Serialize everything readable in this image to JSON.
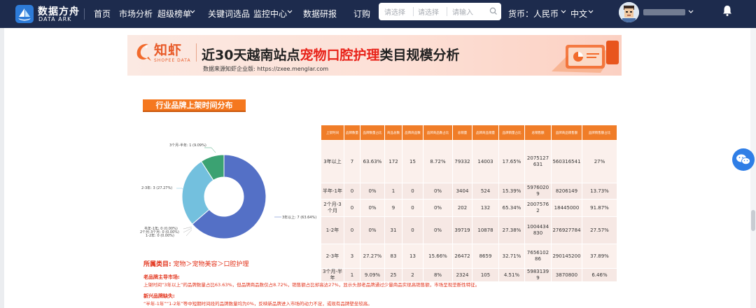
{
  "nav": {
    "logo_cn": "数据方舟",
    "logo_en": "DATA ARK",
    "items": [
      {
        "label": "首页"
      },
      {
        "label": "市场分析"
      },
      {
        "label": "超级榜单"
      },
      {
        "label": "关键词选品"
      },
      {
        "label": "监控中心"
      },
      {
        "label": "数据研报"
      },
      {
        "label": "订购"
      }
    ],
    "search": {
      "select1_placeholder": "请选择",
      "select2_placeholder": "请选择",
      "input_placeholder": "请输入"
    },
    "currency": "货币：人民币",
    "language": "中文"
  },
  "banner": {
    "logo_cn": "知虾",
    "logo_en": "SHOPEE DATA",
    "title_prefix": "近30天越南站点",
    "title_highlight": "宠物口腔护理",
    "title_suffix": "类目规模分析",
    "source": "数据来源知虾企业版: https://zxee.menglar.com"
  },
  "section": {
    "title": "行业品牌上架时间分布"
  },
  "donut": {
    "labels": [
      "3个月-半年: 1 (9.09%)",
      "2-3年: 3 (27.27%)",
      "3年以上: 7 (63.64%)",
      "半年-1年: 0 (0.00%)",
      "2个月-3个月: 0 (0.00%)",
      "1-2年: 0 (0.00%)"
    ],
    "colors": {
      "c1": "#5470c6",
      "c2": "#73c0de",
      "c3": "#3ba272"
    }
  },
  "chart_data": {
    "type": "pie",
    "categories": [
      "3年以上",
      "2-3年",
      "3个月-半年",
      "半年-1年",
      "2个月-3个月",
      "1-2年"
    ],
    "values": [
      7,
      3,
      1,
      0,
      0,
      0
    ]
  },
  "table": {
    "headers": [
      "上架时间",
      "品牌数量",
      "品牌数量占比",
      "商品总数",
      "品牌商品数",
      "品牌商品数占比",
      "总销量",
      "品牌商品销量",
      "品牌销量占比",
      "总销售额",
      "品牌商品销售额",
      "品牌销售额占比"
    ],
    "rows": [
      [
        "3年以上",
        "7",
        "63.63%",
        "172",
        "15",
        "8.72%",
        "79332",
        "14003",
        "17.65%",
        "2075127631",
        "560316541",
        "27%"
      ],
      [
        "半年-1年",
        "0",
        "0%",
        "1",
        "0",
        "0%",
        "3404",
        "524",
        "15.39%",
        "59760209",
        "8206149",
        "13.73%"
      ],
      [
        "2个月-3个月",
        "0",
        "0%",
        "9",
        "0",
        "0%",
        "202",
        "132",
        "65.34%",
        "20075762",
        "18445000",
        "91.87%"
      ],
      [
        "1-2年",
        "0",
        "0%",
        "31",
        "0",
        "0%",
        "39719",
        "10878",
        "27.38%",
        "1004434830",
        "276927784",
        "27.57%"
      ],
      [
        "2-3年",
        "3",
        "27.27%",
        "83",
        "13",
        "15.66%",
        "26472",
        "8659",
        "32.71%",
        "765610286",
        "290145200",
        "37.89%"
      ],
      [
        "3个月-半年",
        "1",
        "9.09%",
        "25",
        "2",
        "8%",
        "2324",
        "105",
        "4.51%",
        "59831399",
        "3870800",
        "6.46%"
      ]
    ]
  },
  "notes": {
    "category_label": "所属类目:",
    "category_path": "宠物＞宠物美容＞口腔护理",
    "n1_title": "老品牌主导市场:",
    "n1_text": "上架时间“3年以上”的品牌数量占比63.63%，但品牌商品数仅占8.72%，销售额占比却高达27%，显示头部老品牌通过少量商品实现高销售额，市场呈现垄断性特征。",
    "n2_title": "新兴品牌缺失:",
    "n2_text": "“半年-1年”“1-2年”等中短期时间段的品牌数量均为0%，反映新品牌进入市场的动力不足，或现有品牌壁垒较高。"
  }
}
